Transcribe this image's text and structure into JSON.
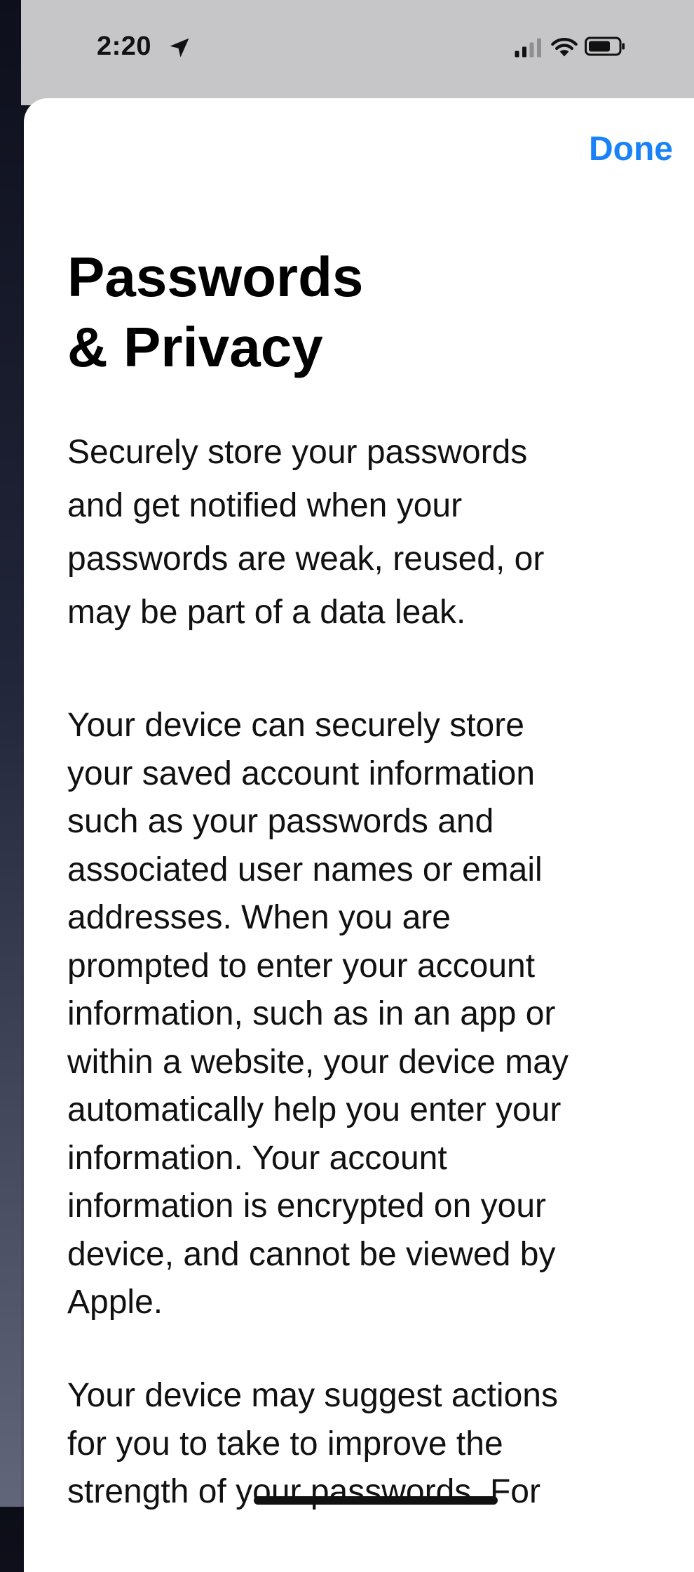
{
  "status_bar": {
    "time": "2:20",
    "icons": [
      "location-arrow-icon",
      "cellular-signal-icon",
      "wifi-icon",
      "battery-icon"
    ]
  },
  "sheet": {
    "done_label": "Done",
    "title_lines": [
      "Passwords",
      "& Privacy"
    ],
    "intro_lines": [
      "Securely store your passwords",
      "and get notified when your",
      "passwords are weak, reused, or",
      "may be part of a data leak."
    ],
    "storage_lines": [
      "Your device can securely store",
      "your saved account information",
      "such as your passwords and",
      "associated user names or email",
      "addresses. When you are",
      "prompted to enter your account",
      "information, such as in an app or",
      "within a website, your device may",
      "automatically help you enter your",
      "information. Your account",
      "information is encrypted on your",
      "device, and cannot be viewed by",
      "Apple."
    ],
    "suggest_lines": [
      "Your device may suggest actions",
      "for you to take to improve the",
      "strength of your passwords. For"
    ]
  },
  "colors": {
    "accent": "#1a82f7",
    "status_bar_bg": "#c6c6c8",
    "sheet_bg": "#ffffff",
    "text": "#111111"
  }
}
